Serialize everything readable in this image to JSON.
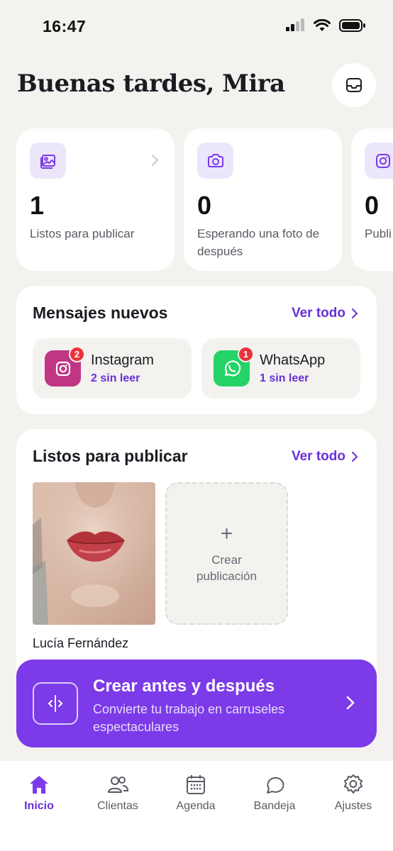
{
  "status_bar": {
    "time": "16:47"
  },
  "header": {
    "greeting": "Buenas tardes, Mira"
  },
  "stats": [
    {
      "icon": "image-icon",
      "value": "1",
      "label": "Listos para publicar"
    },
    {
      "icon": "camera-icon",
      "value": "0",
      "label": "Esperando una foto de después"
    },
    {
      "icon": "instagram-icon",
      "value": "0",
      "label": "Publi"
    }
  ],
  "messages": {
    "title": "Mensajes nuevos",
    "see_all": "Ver todo",
    "channels": [
      {
        "name": "Instagram",
        "unread": "2 sin leer",
        "badge": "2",
        "color": "#c13584"
      },
      {
        "name": "WhatsApp",
        "unread": "1 sin leer",
        "badge": "1",
        "color": "#25d366"
      }
    ]
  },
  "ready": {
    "title": "Listos para publicar",
    "see_all": "Ver todo",
    "items": [
      {
        "client_name": "Lucía Fernández"
      }
    ],
    "create_label": "Crear publicación"
  },
  "cta": {
    "title": "Crear antes y después",
    "subtitle": "Convierte tu trabajo en carruseles espectaculares"
  },
  "nav": [
    {
      "label": "Inicio",
      "icon": "home-icon",
      "active": true
    },
    {
      "label": "Clientas",
      "icon": "people-icon",
      "active": false
    },
    {
      "label": "Agenda",
      "icon": "calendar-icon",
      "active": false
    },
    {
      "label": "Bandeja",
      "icon": "chat-bubble-icon",
      "active": false
    },
    {
      "label": "Ajustes",
      "icon": "settings-icon",
      "active": false
    }
  ],
  "colors": {
    "accent": "#7c3ae8",
    "accent_text": "#6a2fd6",
    "background": "#f3f2ef",
    "badge": "#e8333a"
  }
}
